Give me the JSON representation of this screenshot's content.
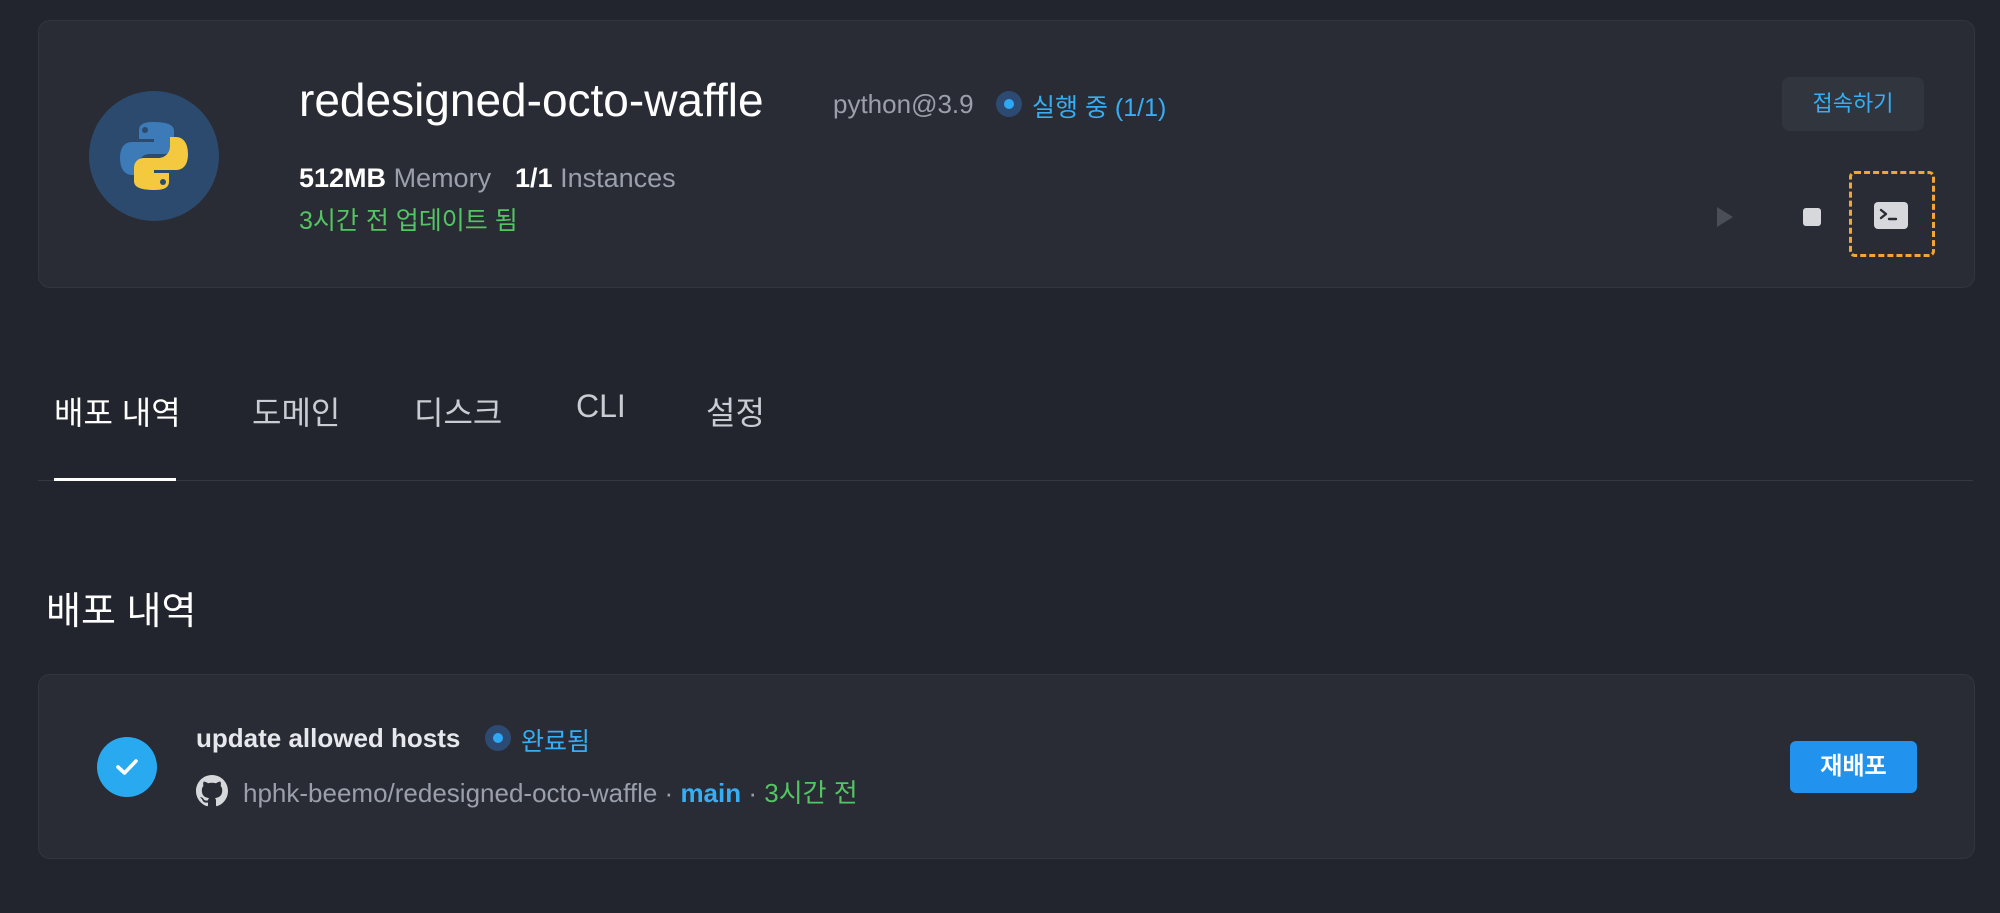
{
  "app": {
    "name": "redesigned-octo-waffle",
    "runtime": "python@3.9",
    "status": "실행 중 (1/1)",
    "memory_value": "512MB",
    "memory_label": "Memory",
    "instances_value": "1/1",
    "instances_label": "Instances",
    "updated": "3시간 전 업데이트 됨",
    "connect_label": "접속하기",
    "icons": {
      "logo": "python-logo-icon",
      "play": "play-icon",
      "stop": "stop-icon",
      "terminal": "terminal-icon"
    }
  },
  "tabs": [
    {
      "label": "배포 내역",
      "active": true
    },
    {
      "label": "도메인",
      "active": false
    },
    {
      "label": "디스크",
      "active": false
    },
    {
      "label": "CLI",
      "active": false
    },
    {
      "label": "설정",
      "active": false
    }
  ],
  "deploy_section": {
    "title": "배포 내역",
    "items": [
      {
        "message": "update allowed hosts",
        "status": "완료됨",
        "repo": "hphk-beemo/redesigned-octo-waffle",
        "branch": "main",
        "time": "3시간 전",
        "redeploy_label": "재배포"
      }
    ]
  },
  "colors": {
    "background": "#22252d",
    "card": "#292c35",
    "accent_blue": "#35aef5",
    "success_green": "#54c563",
    "highlight_orange": "#f3a635",
    "primary_button": "#2193ee"
  }
}
